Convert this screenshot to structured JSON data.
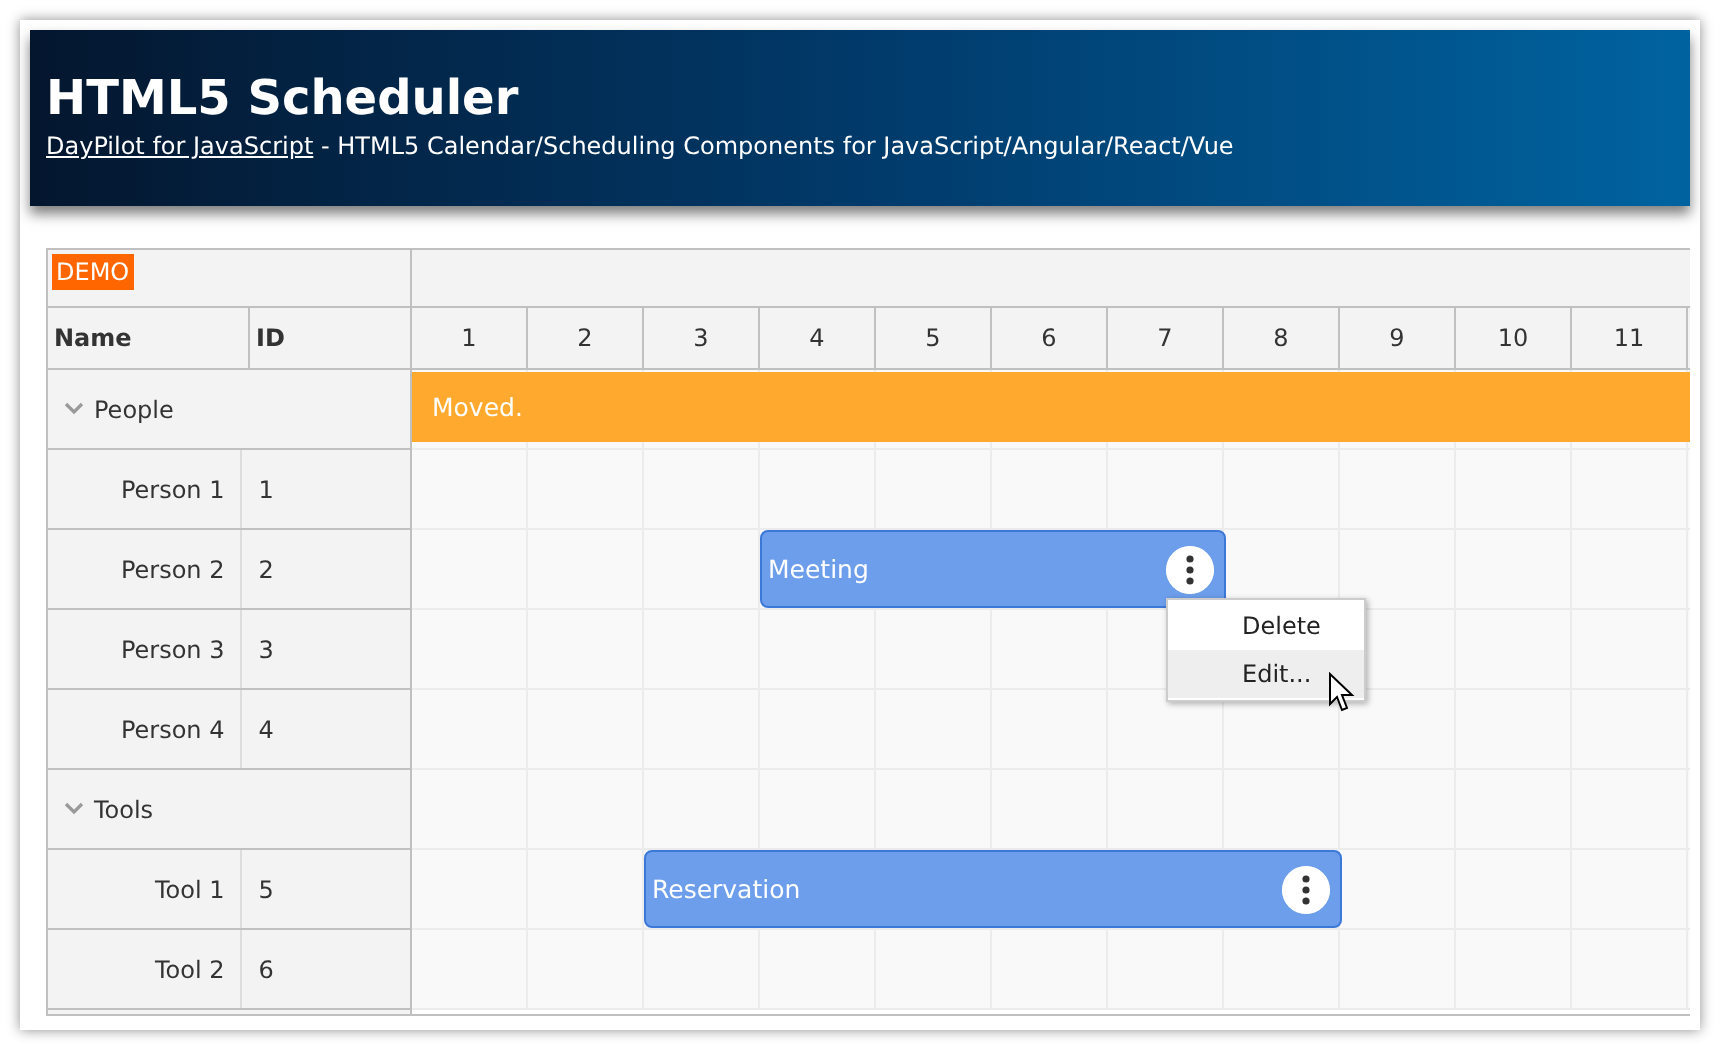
{
  "header": {
    "title": "HTML5 Scheduler",
    "link": "DayPilot for JavaScript",
    "tagline": " - HTML5 Calendar/Scheduling Components for JavaScript/Angular/React/Vue"
  },
  "scheduler": {
    "badge": "DEMO",
    "columns": [
      {
        "label": "Name"
      },
      {
        "label": "ID"
      }
    ],
    "timeline": [
      "1",
      "2",
      "3",
      "4",
      "5",
      "6",
      "7",
      "8",
      "9",
      "10",
      "11"
    ],
    "resources": [
      {
        "name": "People",
        "expanded": true,
        "events": [
          {
            "kind": "message",
            "text": "Moved."
          }
        ],
        "children": [
          {
            "name": "Person 1",
            "number": "1"
          },
          {
            "name": "Person 2",
            "number": "2",
            "events": [
              {
                "kind": "event",
                "text": "Meeting",
                "menu": {
                  "items": [
                    {
                      "label": "Delete",
                      "selected": false
                    },
                    {
                      "label": "Edit...",
                      "selected": true
                    }
                  ]
                }
              }
            ]
          },
          {
            "name": "Person 3",
            "number": "3"
          },
          {
            "name": "Person 4",
            "number": "4"
          }
        ]
      },
      {
        "name": "Tools",
        "expanded": true,
        "children": [
          {
            "name": "Tool 1",
            "number": "5",
            "events": [
              {
                "kind": "event",
                "text": "Reservation"
              }
            ]
          },
          {
            "name": "Tool 2",
            "number": "6"
          }
        ]
      }
    ]
  }
}
